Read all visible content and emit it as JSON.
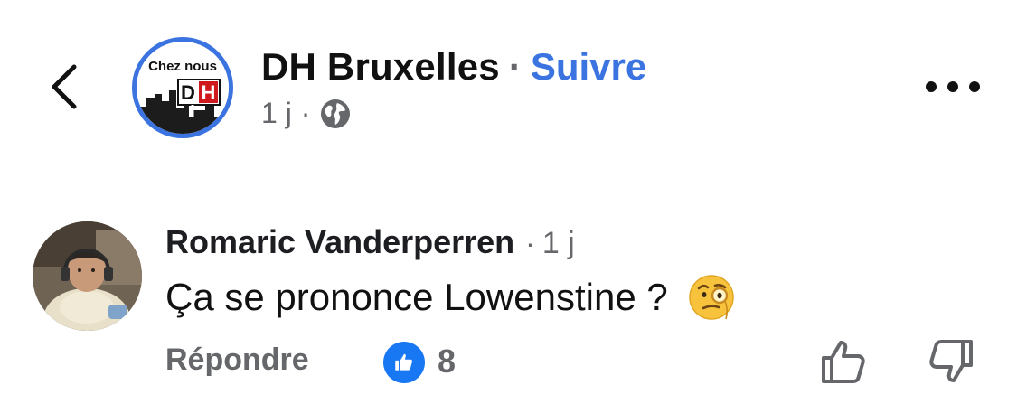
{
  "header": {
    "back_icon": "chevron-left-icon",
    "page_name": "DH Bruxelles",
    "separator": "·",
    "follow_label": "Suivre",
    "time": "1 j",
    "meta_separator": "·",
    "audience_icon": "globe-icon",
    "more_icon": "more-horizontal-icon",
    "logo": {
      "line1": "Chez nous",
      "badge": "DH"
    },
    "accent_color": "#3b73e0"
  },
  "comment": {
    "author": "Romaric Vanderperren",
    "separator": "·",
    "time": "1 j",
    "text": "Ça se prononce Lowenstine ?",
    "emoji": "face-with-monocle",
    "actions": {
      "reply_label": "Répondre",
      "like_icon": "like-badge-icon",
      "like_count": "8",
      "thumb_up_icon": "thumbs-up-icon",
      "thumb_down_icon": "thumbs-down-icon"
    }
  }
}
